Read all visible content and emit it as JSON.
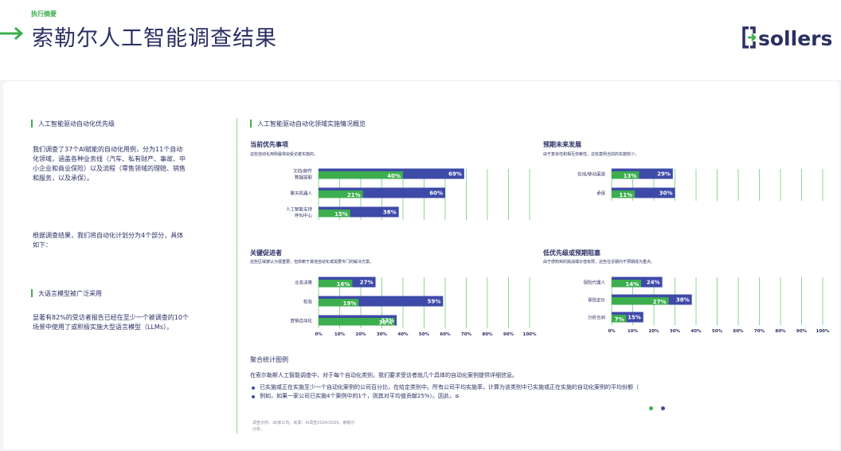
{
  "header": {
    "exec_label": "执行摘要",
    "title": "索勒尔人工智能调查结果",
    "logo_text": "sollers"
  },
  "left": {
    "section1_title": "人工智能驱动自动化优先级",
    "para1_lines": [
      "我们调查了37个AI赋能的自动化用例，分为11个自动",
      "化领域，涵盖各种业务线（汽车、私有财产、事故、中",
      "小企业和商业保险）以及流程（零售领域的理赔、销售",
      "和服务，以及承保）。"
    ],
    "para2_lines": [
      "根据调查结果，我们将自动化计划分为4个部分，具体",
      "如下："
    ],
    "section2_title": "大语言模型被广泛采用",
    "para3_lines": [
      "显著有82%的受访者报告已经在至少一个被调查的10个",
      "场景中使用了或积极实施大型语言模型（LLMs）。"
    ]
  },
  "right_title": "人工智能驱动自动化领域实施情况概览",
  "colors": {
    "implemented": "#3cae4e",
    "planned": "#3e4aa8",
    "accent": "#3cae4e",
    "text": "#2b2f63"
  },
  "legend": {
    "title": "聚合统计图例",
    "text": "在索尔勒斯人工智能调查中，对于每个自动化类别，我们要求受访者就几个具体的自动化案例提供详细信息。",
    "line1": "已实施或正在实施至少一个自动化案例的公司百分比，在给定类别中。所有公司平均实施率，计算为该类别中已实施或正在实施的自动化案例的平均份额（",
    "line2": "例如，如果一家公司已实施4个案例中的1个，则其对平均值贡献25%）。因此，≤",
    "footnote": "调查示例：36家公司。来源：AI调查2024/2025。索勒尔分析。"
  },
  "chart_data": [
    {
      "type": "bar",
      "title": "当前优先事项",
      "subtitle": "这些自动化用例最常由受访者实施的。",
      "categories": [
        [
          "文档/邮件",
          "数据提取"
        ],
        [
          "聊天机器人"
        ],
        [
          "人工智能支持",
          "呼叫中心"
        ]
      ],
      "series": [
        {
          "values": [
            40,
            21,
            15
          ]
        },
        {
          "values": [
            69,
            60,
            38
          ]
        }
      ],
      "xlim": [
        0,
        100
      ]
    },
    {
      "type": "bar",
      "title": "预期未来发展",
      "subtitle": "由于复杂性和相互依赖性，这些案例当前的实施较少。",
      "categories": [
        [
          "在线/移动渠道"
        ],
        [
          "承保"
        ]
      ],
      "series": [
        {
          "values": [
            13,
            11
          ]
        },
        {
          "values": [
            29,
            30
          ]
        }
      ],
      "xlim": [
        0,
        100
      ]
    },
    {
      "type": "bar",
      "title": "关键促进者",
      "subtitle": "这些区域被认为很重要，但依赖于其他自动化或需要专门的解决方案。",
      "categories": [
        [
          "业务决策"
        ],
        [
          "检验"
        ],
        [
          "营销自动化"
        ]
      ],
      "series": [
        {
          "values": [
            16,
            19,
            36
          ]
        },
        {
          "values": [
            27,
            59,
            37
          ]
        }
      ],
      "xlim": [
        0,
        100
      ],
      "ticks": [
        "0%",
        "10%",
        "20%",
        "30%",
        "40%",
        "50%",
        "60%",
        "70%",
        "80%",
        "90%",
        "100%"
      ]
    },
    {
      "type": "bar",
      "title": "低优先级或预期阻塞",
      "subtitle": "由于感知到的挑战或价值有限，这些在近期内不预期成为重点。",
      "categories": [
        [
          "保险代理人"
        ],
        [
          "保险定价"
        ],
        [
          "分析合同"
        ]
      ],
      "series": [
        {
          "values": [
            14,
            27,
            7
          ]
        },
        {
          "values": [
            24,
            38,
            15
          ]
        }
      ],
      "xlim": [
        0,
        100
      ],
      "ticks": [
        "0%",
        "10%",
        "20%",
        "30%",
        "40%",
        "50%",
        "60%",
        "70%",
        "80%",
        "90%",
        "100%"
      ]
    }
  ]
}
